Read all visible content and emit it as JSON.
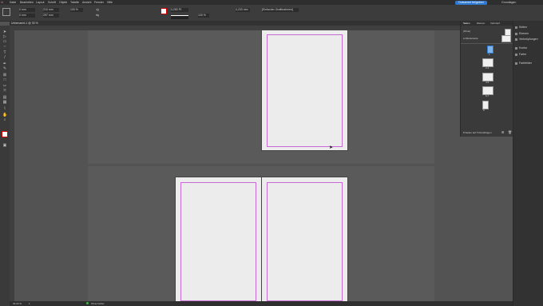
{
  "menu": [
    "Datei",
    "Bearbeiten",
    "Layout",
    "Schrift",
    "Objekt",
    "Tabelle",
    "Ansicht",
    "Fenster",
    "Hilfe"
  ],
  "top_right": {
    "share_button": "Dokument freigeben",
    "workspace": "Grundlagen"
  },
  "options": {
    "x": "0 mm",
    "y": "0 mm",
    "w": "210 mm",
    "h": "297 mm",
    "zoom": "100 %",
    "stroke": "0,283 Pt",
    "style_box": "[Einfacher Grafikrahmen]",
    "corner": "4,233 mm",
    "tint": "100 %"
  },
  "document_tab": "Unbenannt-1 @ 33 %",
  "pages_panel": {
    "tabs": [
      "Seiten",
      "Ebenen",
      "Verknüpf."
    ],
    "none_label": "[Ohne]",
    "master_label": "A-Musterseite",
    "page_labels": [
      "1",
      "2-3",
      "4-5",
      "6-7",
      "8"
    ],
    "footer": "8 Seiten auf 5 Druckbögen"
  },
  "right_panel": [
    "Seiten",
    "Ebenen",
    "Verknüpfungen",
    "Kontur",
    "Farbe",
    "Farbfelder"
  ],
  "status": {
    "zoom": "33,33 %",
    "page": "1",
    "preflight": "Ohne Fehler"
  }
}
